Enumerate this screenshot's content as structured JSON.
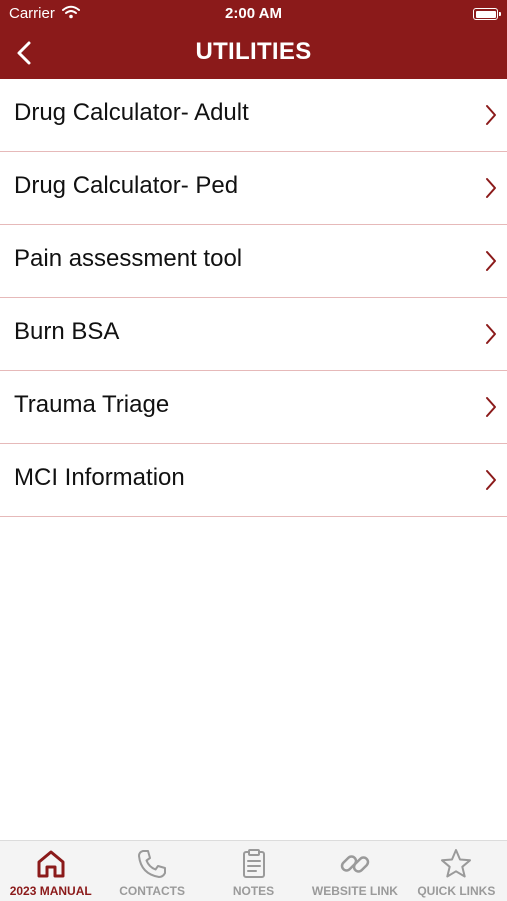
{
  "status_bar": {
    "carrier": "Carrier",
    "time": "2:00 AM"
  },
  "nav": {
    "title": "UTILITIES"
  },
  "items": [
    {
      "label": "Drug Calculator- Adult"
    },
    {
      "label": "Drug Calculator- Ped"
    },
    {
      "label": "Pain assessment tool"
    },
    {
      "label": "Burn BSA"
    },
    {
      "label": "Trauma Triage"
    },
    {
      "label": "MCI Information"
    }
  ],
  "tabs": [
    {
      "label": "2023 MANUAL",
      "icon": "home-icon",
      "active": true
    },
    {
      "label": "CONTACTS",
      "icon": "phone-icon",
      "active": false
    },
    {
      "label": "NOTES",
      "icon": "clipboard-icon",
      "active": false
    },
    {
      "label": "WEBSITE LINK",
      "icon": "link-icon",
      "active": false
    },
    {
      "label": "QUICK LINKS",
      "icon": "star-icon",
      "active": false
    }
  ],
  "colors": {
    "brand": "#8b1a1a",
    "divider": "#e6b9b9",
    "inactive": "#9a9a9a"
  }
}
